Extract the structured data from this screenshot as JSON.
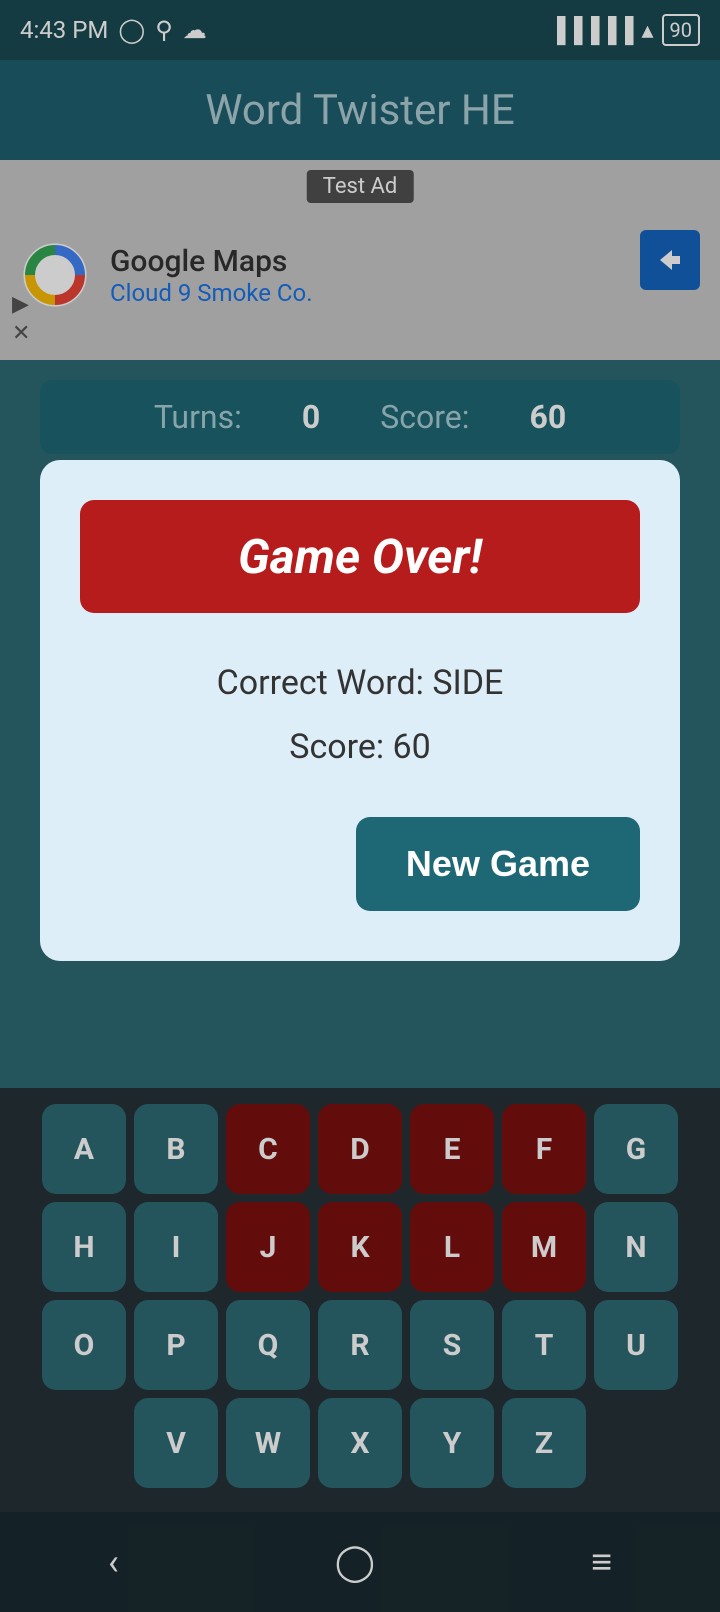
{
  "statusBar": {
    "time": "4:43 PM",
    "battery": "90"
  },
  "header": {
    "title": "Word Twister HE"
  },
  "ad": {
    "label": "Test Ad",
    "company": "Google Maps",
    "sub": "Cloud 9 Smoke Co."
  },
  "scoreBar": {
    "turnsLabel": "Turns:",
    "turnsValue": "0",
    "scoreLabel": "Score:",
    "scoreValue": "60"
  },
  "modal": {
    "gameOverLabel": "Game Over!",
    "correctWordLabel": "Correct Word: SIDE",
    "scoreLabel": "Score: 60",
    "newGameLabel": "New Game"
  },
  "keyboard": {
    "rows": [
      [
        {
          "letter": "A",
          "used": false
        },
        {
          "letter": "B",
          "used": false
        },
        {
          "letter": "C",
          "used": true
        },
        {
          "letter": "D",
          "used": true
        },
        {
          "letter": "E",
          "used": true
        },
        {
          "letter": "F",
          "used": true
        },
        {
          "letter": "G",
          "used": false
        }
      ],
      [
        {
          "letter": "H",
          "used": false
        },
        {
          "letter": "I",
          "used": false
        },
        {
          "letter": "J",
          "used": true
        },
        {
          "letter": "K",
          "used": true
        },
        {
          "letter": "L",
          "used": true
        },
        {
          "letter": "M",
          "used": true
        },
        {
          "letter": "N",
          "used": false
        }
      ],
      [
        {
          "letter": "O",
          "used": false
        },
        {
          "letter": "P",
          "used": false
        },
        {
          "letter": "Q",
          "used": false
        },
        {
          "letter": "R",
          "used": false
        },
        {
          "letter": "S",
          "used": false
        },
        {
          "letter": "T",
          "used": false
        },
        {
          "letter": "U",
          "used": false
        }
      ],
      [
        {
          "letter": "V",
          "used": false
        },
        {
          "letter": "W",
          "used": false
        },
        {
          "letter": "X",
          "used": false
        },
        {
          "letter": "Y",
          "used": false
        },
        {
          "letter": "Z",
          "used": false
        }
      ]
    ]
  },
  "colors": {
    "keyNormal": "#2e6b75",
    "keyUsed": "#7b1010",
    "modalBg": "#ddeef8",
    "gameOverRed": "#b71c1c",
    "newGameTeal": "#1e6875"
  }
}
